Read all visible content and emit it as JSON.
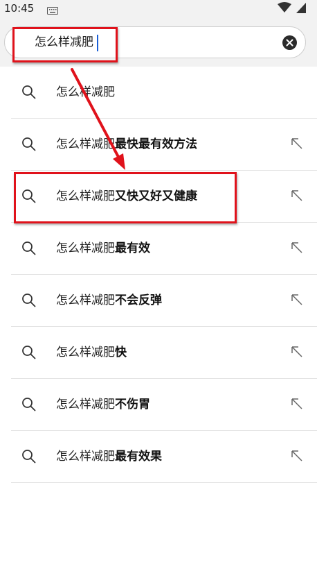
{
  "status_bar": {
    "time": "10:45",
    "icons": [
      "keyboard-icon",
      "wifi-icon",
      "battery-icon"
    ]
  },
  "search": {
    "query": "怎么样减肥",
    "clear_icon": "clear-icon"
  },
  "suggestions": [
    {
      "prefix": "怎么样减肥",
      "suffix": "",
      "fill_arrow": false
    },
    {
      "prefix": "怎么样减肥",
      "suffix": "最快最有效方法",
      "fill_arrow": true
    },
    {
      "prefix": "怎么样减肥",
      "suffix": "又快又好又健康",
      "fill_arrow": true
    },
    {
      "prefix": "怎么样减肥",
      "suffix": "最有效",
      "fill_arrow": true
    },
    {
      "prefix": "怎么样减肥",
      "suffix": "不会反弹",
      "fill_arrow": true
    },
    {
      "prefix": "怎么样减肥",
      "suffix": "快",
      "fill_arrow": true
    },
    {
      "prefix": "怎么样减肥",
      "suffix": "不伤胃",
      "fill_arrow": true
    },
    {
      "prefix": "怎么样减肥",
      "suffix": "最有效果",
      "fill_arrow": true
    }
  ],
  "annotation": {
    "color": "#e0121b"
  }
}
